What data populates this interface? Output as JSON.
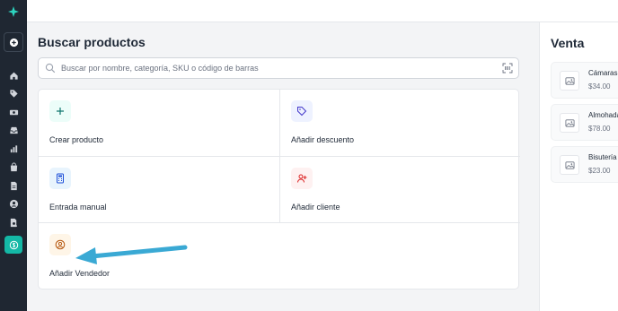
{
  "colors": {
    "sidebar_bg": "#1f2732",
    "accent": "#14b8a6",
    "annotation_arrow": "#3aa9d4"
  },
  "sidebar": {
    "items": [
      {
        "icon": "home-icon"
      },
      {
        "icon": "tag-icon"
      },
      {
        "icon": "cash-icon"
      },
      {
        "icon": "inbox-icon"
      },
      {
        "icon": "chart-icon"
      },
      {
        "icon": "bag-icon"
      },
      {
        "icon": "document-icon"
      },
      {
        "icon": "user-icon"
      },
      {
        "icon": "report-icon"
      },
      {
        "icon": "dollar-icon"
      }
    ]
  },
  "main": {
    "title": "Buscar productos",
    "search_placeholder": "Buscar por nombre, categoría, SKU o código de barras",
    "actions": [
      {
        "label": "Crear producto",
        "icon": "plus-icon",
        "bg": "#ecfdf9"
      },
      {
        "label": "Añadir descuento",
        "icon": "tag-icon",
        "bg": "#eef2ff"
      },
      {
        "label": "Entrada manual",
        "icon": "calculator-icon",
        "bg": "#e8f4fd"
      },
      {
        "label": "Añadir cliente",
        "icon": "user-plus-icon",
        "bg": "#fef1f1"
      },
      {
        "label": "Añadir Vendedor",
        "icon": "user-circle-icon",
        "bg": "#fef5e7"
      }
    ]
  },
  "venta": {
    "title": "Venta",
    "products": [
      {
        "name": "Cámaras f",
        "price": "$34.00"
      },
      {
        "name": "Almohada",
        "price": "$78.00"
      },
      {
        "name": "Bisutería d",
        "price": "$23.00"
      }
    ]
  }
}
